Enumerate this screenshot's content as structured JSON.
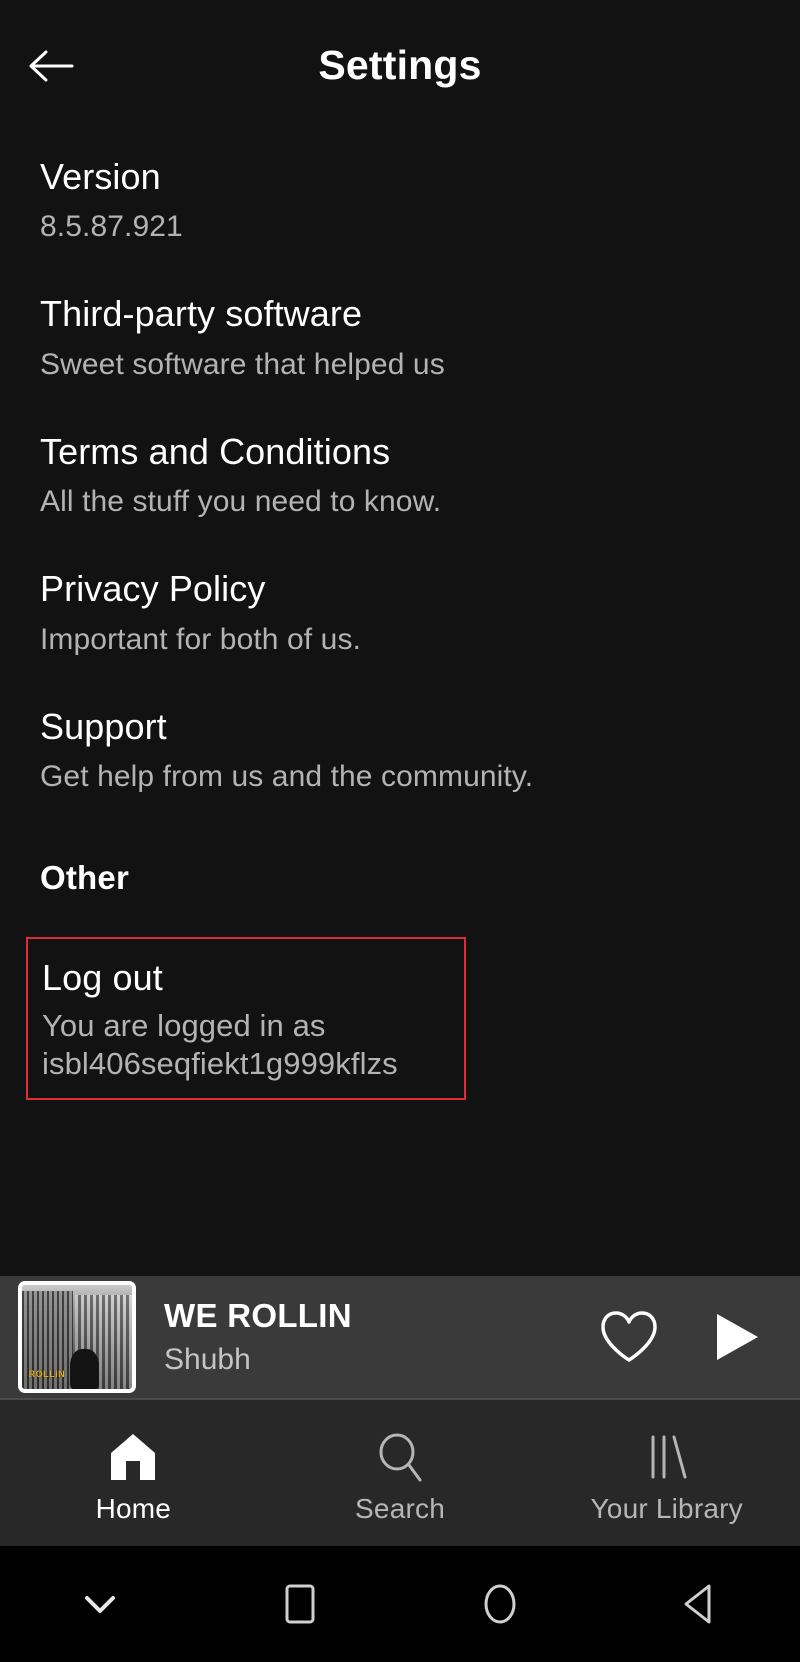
{
  "header": {
    "title": "Settings",
    "back_icon": "arrow-left-icon"
  },
  "settings": {
    "items": [
      {
        "title": "Version",
        "subtitle": "8.5.87.921"
      },
      {
        "title": "Third-party software",
        "subtitle": "Sweet software that helped us"
      },
      {
        "title": "Terms and Conditions",
        "subtitle": "All the stuff you need to know."
      },
      {
        "title": "Privacy Policy",
        "subtitle": "Important for both of us."
      },
      {
        "title": "Support",
        "subtitle": "Get help from us and the community."
      }
    ],
    "other_section_title": "Other",
    "logout": {
      "title": "Log out",
      "subtitle_line1": "You are logged in as",
      "subtitle_line2": "isbl406seqfiekt1g999kflzs",
      "highlight_color": "#e02b34"
    }
  },
  "now_playing": {
    "track_title": "WE ROLLIN",
    "artist": "Shubh",
    "album_art_label": "ROLLIN",
    "like_icon": "heart-outline-icon",
    "play_icon": "play-icon",
    "background_color": "#3a3a3a"
  },
  "tab_bar": {
    "tabs": [
      {
        "label": "Home",
        "icon": "home-icon",
        "active": true
      },
      {
        "label": "Search",
        "icon": "search-icon",
        "active": false
      },
      {
        "label": "Your Library",
        "icon": "library-icon",
        "active": false
      }
    ]
  },
  "system_nav": {
    "buttons": [
      {
        "icon": "chevron-down-icon"
      },
      {
        "icon": "square-recents-icon"
      },
      {
        "icon": "circle-home-icon"
      },
      {
        "icon": "triangle-back-icon"
      }
    ]
  }
}
